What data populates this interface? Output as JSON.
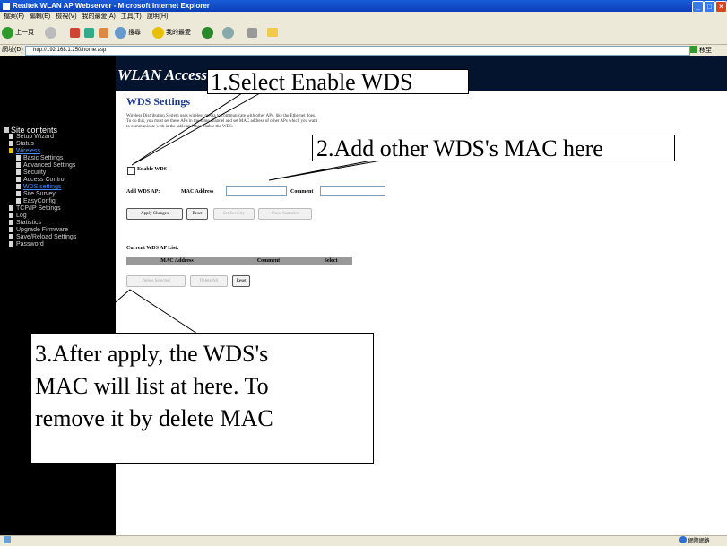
{
  "window": {
    "title": "Realtek WLAN AP Webserver - Microsoft Internet Explorer",
    "menu": [
      "檔案(F)",
      "編輯(E)",
      "檢視(V)",
      "我的最愛(A)",
      "工具(T)",
      "說明(H)"
    ]
  },
  "toolbar": {
    "back_label": "上一頁",
    "search_label": "搜尋",
    "favorites_label": "我的最愛"
  },
  "address": {
    "label": "網址(D)",
    "url": "http://192.168.1.250/home.asp",
    "go_label": "移至"
  },
  "banner": {
    "title": "WLAN Access"
  },
  "sidebar": {
    "heading": "Site contents",
    "items": [
      {
        "label": "Setup Wizard"
      },
      {
        "label": "Status"
      },
      {
        "label": "Wireless"
      },
      {
        "label": "Basic Settings"
      },
      {
        "label": "Advanced Settings"
      },
      {
        "label": "Security"
      },
      {
        "label": "Access Control"
      },
      {
        "label": "WDS settings"
      },
      {
        "label": "Site Survey"
      },
      {
        "label": "EasyConfig"
      },
      {
        "label": "TCP/IP Settings"
      },
      {
        "label": "Log"
      },
      {
        "label": "Statistics"
      },
      {
        "label": "Upgrade Firmware"
      },
      {
        "label": "Save/Reload Settings"
      },
      {
        "label": "Password"
      }
    ]
  },
  "main": {
    "heading": "WDS Settings",
    "description": "Wireless Distribution System uses wireless media to communicate with other APs, like the Ethernet does. To do this, you must set these APs in the same channel and set MAC address of other APs which you want to communicate with in the table and then enable the WDS.",
    "enable_label": "Enable WDS",
    "add_label": "Add WDS AP:",
    "mac_label": "MAC Address",
    "comment_label": "Comment",
    "buttons": {
      "apply": "Apply Changes",
      "reset": "Reset",
      "set_security": "Set Security",
      "show_statistics": "Show Statistics",
      "delete_selected": "Delete Selected",
      "delete_all": "Delete All",
      "reset2": "Reset"
    },
    "list_title": "Current WDS AP List:",
    "table_headers": [
      "MAC Address",
      "Comment",
      "Select"
    ]
  },
  "callouts": {
    "c1": "1.Select Enable WDS",
    "c2": "2.Add other WDS's MAC here",
    "c3_lines": [
      "3.After apply, the WDS's",
      "MAC will list at here. To",
      "remove it by delete MAC"
    ]
  },
  "status": {
    "zone": "網際網路"
  }
}
